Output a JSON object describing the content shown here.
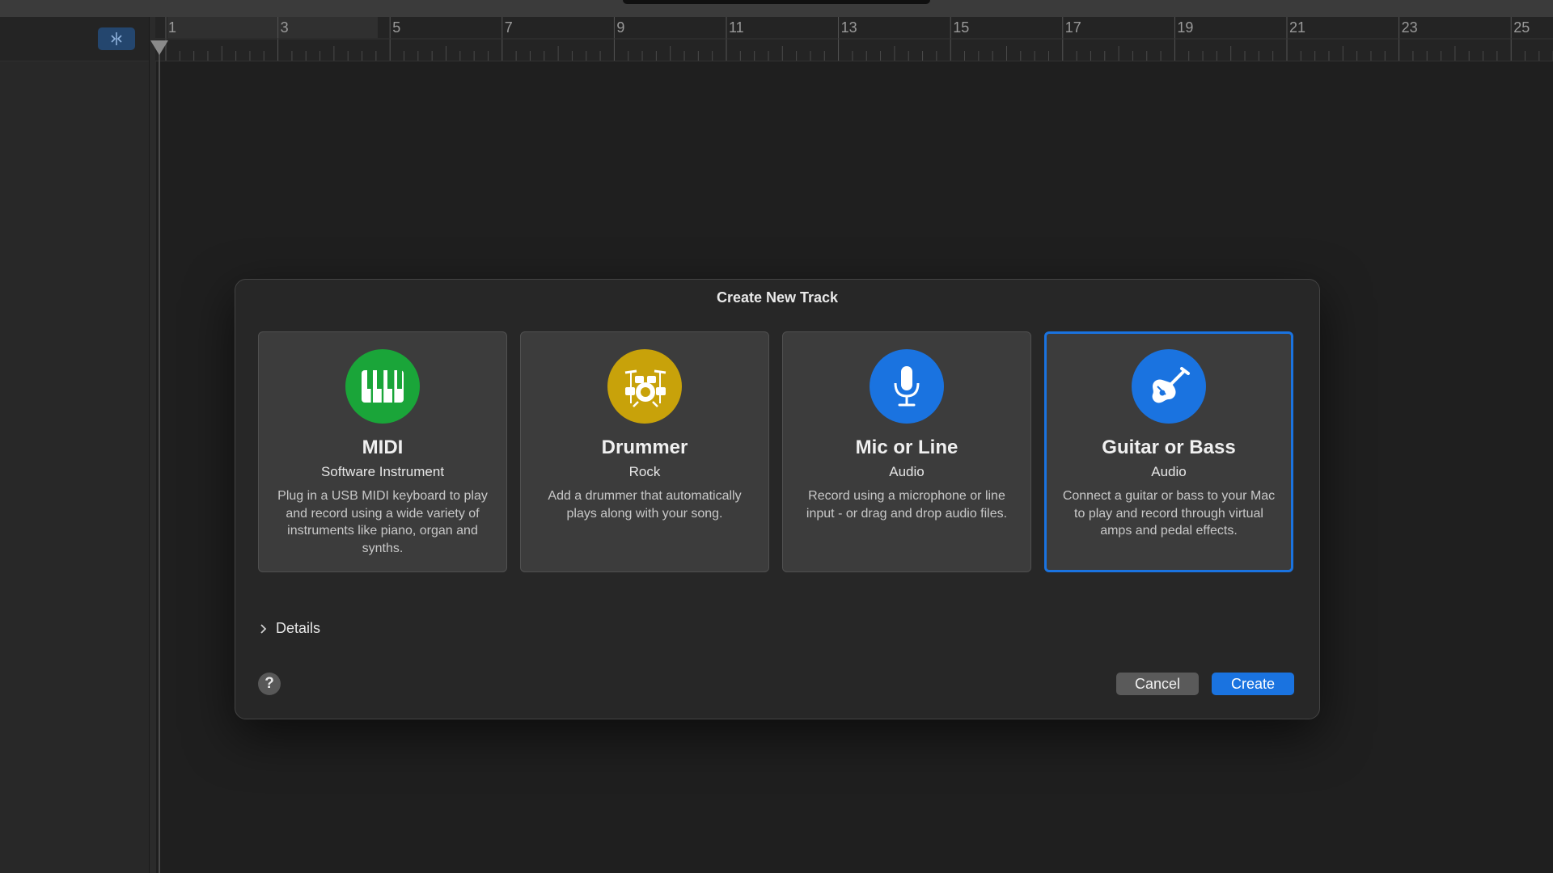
{
  "ruler": {
    "bars": [
      "1",
      "3",
      "5",
      "7",
      "9",
      "11",
      "13",
      "15",
      "17",
      "19",
      "21",
      "23",
      "25"
    ]
  },
  "dialog": {
    "title": "Create New Track",
    "cards": [
      {
        "title": "MIDI",
        "subtitle": "Software Instrument",
        "description": "Plug in a USB MIDI keyboard to play and record using a wide variety of instruments like piano, organ and synths.",
        "icon": "piano-keys-icon",
        "color": "#1aa539"
      },
      {
        "title": "Drummer",
        "subtitle": "Rock",
        "description": "Add a drummer that automatically plays along with your song.",
        "icon": "drum-kit-icon",
        "color": "#c8a20a"
      },
      {
        "title": "Mic or Line",
        "subtitle": "Audio",
        "description": "Record using a microphone or line input - or drag and drop audio files.",
        "icon": "microphone-icon",
        "color": "#1a73e0"
      },
      {
        "title": "Guitar or Bass",
        "subtitle": "Audio",
        "description": "Connect a guitar or bass to your Mac to play and record through virtual amps and pedal effects.",
        "icon": "guitar-icon",
        "color": "#1a73e0"
      }
    ],
    "selected_card": "Guitar or Bass",
    "details_label": "Details",
    "help_label": "?",
    "cancel_label": "Cancel",
    "create_label": "Create"
  },
  "colors": {
    "accent": "#1a73e0",
    "background": "#1f1f1f",
    "card": "#3c3c3c"
  }
}
